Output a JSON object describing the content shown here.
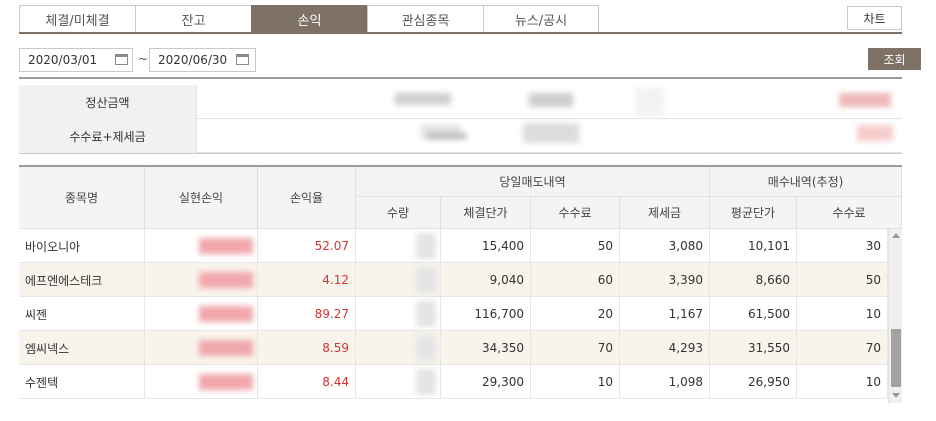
{
  "tabs": [
    {
      "label": "체결/미체결"
    },
    {
      "label": "잔고"
    },
    {
      "label": "손익"
    },
    {
      "label": "관심종목"
    },
    {
      "label": "뉴스/공시"
    }
  ],
  "active_tab": "손익",
  "chart_button": "차트",
  "date_range": {
    "start": "2020/03/01",
    "separator": "~",
    "end": "2020/06/30"
  },
  "query_button": "조회",
  "summary": {
    "settlement_label": "정산금액",
    "fee_tax_label": "수수료+제세금"
  },
  "table": {
    "headers": {
      "name": "종목명",
      "realized_pl": "실현손익",
      "return_rate": "손익율",
      "sell_group": "당일매도내역",
      "buy_group": "매수내역(추정)",
      "qty": "수량",
      "exec_price": "체결단가",
      "sell_fee": "수수료",
      "tax": "제세금",
      "avg_price": "평균단가",
      "buy_fee": "수수료"
    },
    "rows": [
      {
        "name": "바이오니아",
        "rate": "52.07",
        "exec_price": "15,400",
        "fee": "50",
        "tax": "3,080",
        "avg_price": "10,101",
        "buy_fee": "30"
      },
      {
        "name": "에프엔에스테크",
        "rate": "4.12",
        "exec_price": "9,040",
        "fee": "60",
        "tax": "3,390",
        "avg_price": "8,660",
        "buy_fee": "50"
      },
      {
        "name": "씨젠",
        "rate": "89.27",
        "exec_price": "116,700",
        "fee": "20",
        "tax": "1,167",
        "avg_price": "61,500",
        "buy_fee": "10"
      },
      {
        "name": "엠씨넥스",
        "rate": "8.59",
        "exec_price": "34,350",
        "fee": "70",
        "tax": "4,293",
        "avg_price": "31,550",
        "buy_fee": "70"
      },
      {
        "name": "수젠텍",
        "rate": "8.44",
        "exec_price": "29,300",
        "fee": "10",
        "tax": "1,098",
        "avg_price": "26,950",
        "buy_fee": "10"
      }
    ]
  },
  "colors": {
    "accent": "#7e7166",
    "profit_red": "#d63333",
    "alt_row": "#f8f4ec"
  }
}
